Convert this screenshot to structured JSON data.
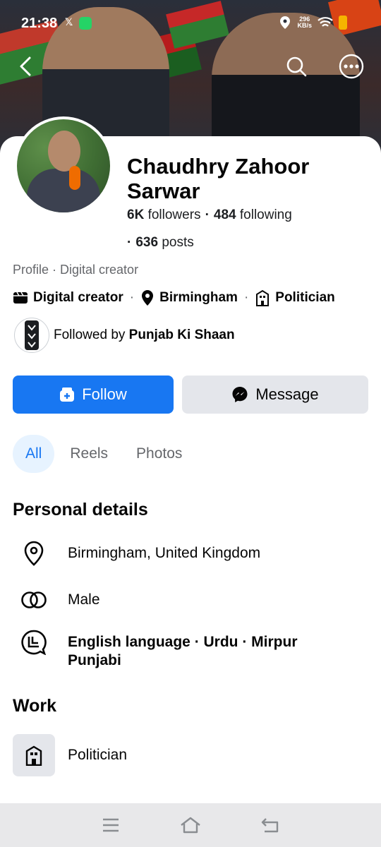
{
  "status_bar": {
    "time": "21:38",
    "network_speed_value": "296",
    "network_speed_unit": "KB/s",
    "icons": [
      "x-icon",
      "whatsapp-icon",
      "location-icon",
      "wifi-icon",
      "battery-icon"
    ]
  },
  "header": {
    "icons": [
      "back-arrow-icon",
      "search-icon",
      "more-options-icon"
    ]
  },
  "profile": {
    "name": "Chaudhry Zahoor Sarwar",
    "followers_count": "6K",
    "followers_label": "followers",
    "following_count": "484",
    "following_label": "following",
    "posts_count": "636",
    "posts_label": "posts",
    "bullet": "·",
    "category_line": "Profile · Digital creator",
    "meta": [
      {
        "label": "Digital creator",
        "icon": "video-icon"
      },
      {
        "label": "Birmingham",
        "icon": "location-pin-icon"
      },
      {
        "label": "Politician",
        "icon": "building-icon"
      }
    ],
    "followed_by_prefix": "Followed by",
    "followed_by_name": "Punjab Ki Shaan"
  },
  "actions": {
    "follow_label": "Follow",
    "message_label": "Message"
  },
  "tabs": [
    {
      "label": "All",
      "active": true
    },
    {
      "label": "Reels",
      "active": false
    },
    {
      "label": "Photos",
      "active": false
    }
  ],
  "personal_details": {
    "title": "Personal details",
    "items": [
      {
        "text": "Birmingham, United Kingdom",
        "icon": "location-pin-icon"
      },
      {
        "text": "Male",
        "icon": "gender-rings-icon"
      },
      {
        "text": "English language · Urdu · Mirpur Punjabi",
        "icon": "language-bubble-icon"
      }
    ]
  },
  "work": {
    "title": "Work",
    "items": [
      {
        "text": "Politician",
        "icon": "building-icon"
      }
    ]
  },
  "nav_bar": {
    "icons": [
      "menu-icon",
      "home-icon",
      "back-icon"
    ]
  },
  "colors": {
    "primary": "#1877f2",
    "button_gray": "#e4e6eb",
    "text": "#050505",
    "secondary_text": "#65676b",
    "active_tab_bg": "#e7f3ff"
  }
}
